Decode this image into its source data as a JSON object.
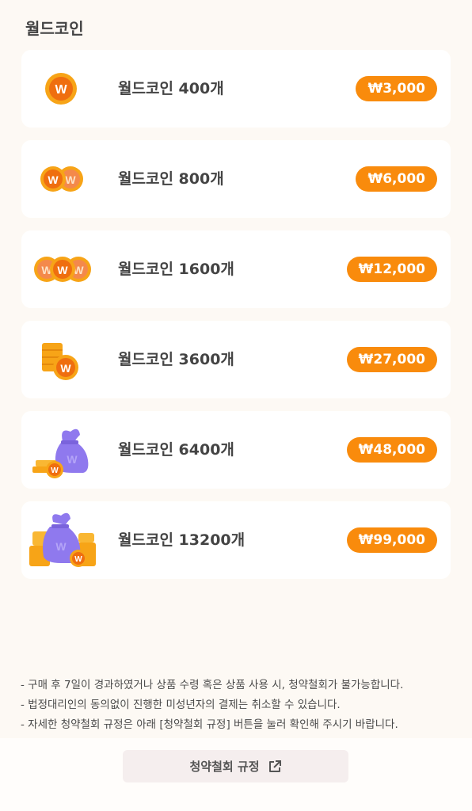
{
  "header": {
    "title": "월드코인"
  },
  "products": [
    {
      "name": "월드코인 400개",
      "price": "₩3,000",
      "icon": "single-coin-icon"
    },
    {
      "name": "월드코인 800개",
      "price": "₩6,000",
      "icon": "two-coins-icon"
    },
    {
      "name": "월드코인 1600개",
      "price": "₩12,000",
      "icon": "three-coins-icon"
    },
    {
      "name": "월드코인 3600개",
      "price": "₩27,000",
      "icon": "coin-stack-icon"
    },
    {
      "name": "월드코인 6400개",
      "price": "₩48,000",
      "icon": "money-bag-icon"
    },
    {
      "name": "월드코인 13200개",
      "price": "₩99,000",
      "icon": "money-bag-pile-icon"
    }
  ],
  "coin_letter": "W",
  "notes": [
    "- 구매 후 7일이 경과하였거나 상품 수령 혹은 상품 사용 시, 청약철회가 불가능합니다.",
    "- 법정대리인의 동의없이 진행한 미성년자의 결제는 취소할 수 있습니다.",
    "- 자세한 청약철회 규정은 아래 [청약철회 규정] 버튼을 눌러 확인해 주시기 바랍니다."
  ],
  "footer": {
    "policy_button_label": "청약철회 규정"
  },
  "colors": {
    "accent": "#f98b0c",
    "coin": "#f7a417",
    "bag": "#8f79ee",
    "background": "#fdf9f4"
  }
}
